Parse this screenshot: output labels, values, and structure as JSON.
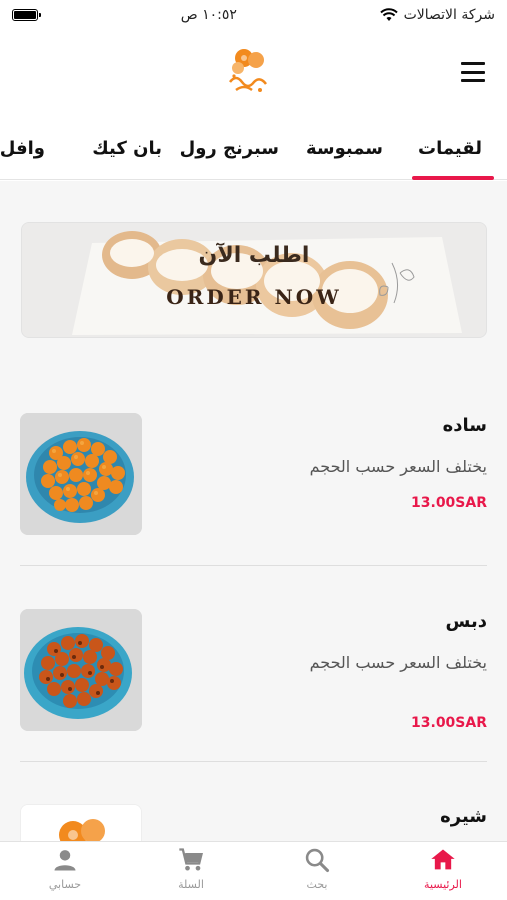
{
  "status_bar": {
    "carrier": "شركة الاتصالات",
    "time": "١٠:٥٢ ص"
  },
  "tabs": [
    {
      "label": "لقيمات",
      "active": true
    },
    {
      "label": "سمبوسة",
      "active": false
    },
    {
      "label": "سبرنج رول",
      "active": false
    },
    {
      "label": "بان كيك",
      "active": false
    },
    {
      "label": "وافل",
      "active": false
    }
  ],
  "banner": {
    "title": "اطلب الآن",
    "subtitle": "ORDER NOW"
  },
  "products": [
    {
      "name": "ساده",
      "description": "يختلف السعر حسب الحجم",
      "price": "13.00SAR"
    },
    {
      "name": "دبس",
      "description": "يختلف السعر حسب الحجم",
      "price": "13.00SAR"
    },
    {
      "name": "شيره"
    }
  ],
  "bottom_nav": [
    {
      "label": "الرئيسية",
      "icon": "home-icon",
      "active": true
    },
    {
      "label": "بحث",
      "icon": "search-icon",
      "active": false
    },
    {
      "label": "السلة",
      "icon": "cart-icon",
      "active": false
    },
    {
      "label": "حسابي",
      "icon": "user-icon",
      "active": false
    }
  ],
  "colors": {
    "accent": "#e8184a",
    "brand_orange": "#f28a1e",
    "background": "#f6f6f6"
  }
}
